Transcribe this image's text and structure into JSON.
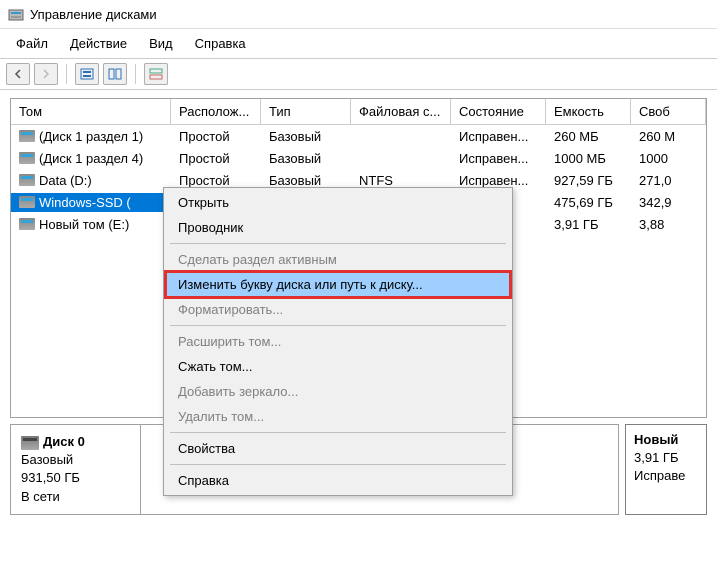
{
  "window": {
    "title": "Управление дисками"
  },
  "menu": {
    "file": "Файл",
    "action": "Действие",
    "view": "Вид",
    "help": "Справка"
  },
  "columns": {
    "volume": "Том",
    "layout": "Располож...",
    "type": "Тип",
    "filesystem": "Файловая с...",
    "status": "Состояние",
    "capacity": "Емкость",
    "free": "Своб"
  },
  "volumes": [
    {
      "name": "(Диск 1 раздел 1)",
      "layout": "Простой",
      "type": "Базовый",
      "fs": "",
      "status": "Исправен...",
      "capacity": "260 МБ",
      "free": "260 М"
    },
    {
      "name": "(Диск 1 раздел 4)",
      "layout": "Простой",
      "type": "Базовый",
      "fs": "",
      "status": "Исправен...",
      "capacity": "1000 МБ",
      "free": "1000"
    },
    {
      "name": "Data (D:)",
      "layout": "Простой",
      "type": "Базовый",
      "fs": "NTFS",
      "status": "Исправен...",
      "capacity": "927,59 ГБ",
      "free": "271,0"
    },
    {
      "name": "Windows-SSD (",
      "layout": "",
      "type": "",
      "fs": "",
      "status": "ен...",
      "capacity": "475,69 ГБ",
      "free": "342,9",
      "selected": true
    },
    {
      "name": "Новый том (E:)",
      "layout": "",
      "type": "",
      "fs": "",
      "status": "ен...",
      "capacity": "3,91 ГБ",
      "free": "3,88"
    }
  ],
  "context_menu": {
    "open": "Открыть",
    "explorer": "Проводник",
    "mark_active": "Сделать раздел активным",
    "change_letter": "Изменить букву диска или путь к диску...",
    "format": "Форматировать...",
    "extend": "Расширить том...",
    "shrink": "Сжать том...",
    "add_mirror": "Добавить зеркало...",
    "delete": "Удалить том...",
    "properties": "Свойства",
    "help": "Справка"
  },
  "disk_panel": {
    "disk_name": "Диск 0",
    "disk_type": "Базовый",
    "disk_size": "931,50 ГБ",
    "disk_status": "В сети",
    "partition": {
      "name": "Новый",
      "size": "3,91 ГБ",
      "status": "Исправе"
    }
  }
}
